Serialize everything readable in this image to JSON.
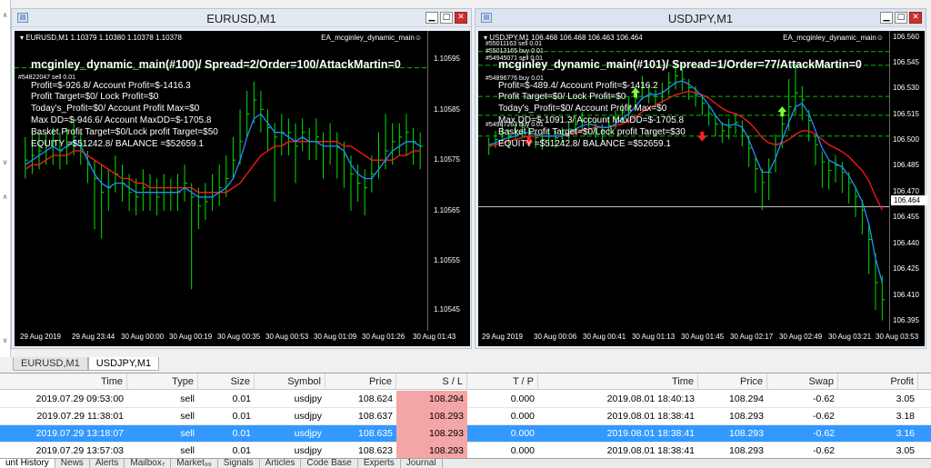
{
  "left_pane": {
    "arrows": [
      "∧",
      "∨",
      "∧",
      "∨"
    ]
  },
  "colors": {
    "bull": "#00e000",
    "ma_fast": "#1e90ff",
    "ma_slow": "#ff1a1a",
    "level": "#00c000",
    "buy_arrow": "#7cff3a",
    "sell_arrow": "#ff2020"
  },
  "charts": [
    {
      "window_title": "EURUSD,M1",
      "header": "▾ EURUSD,M1  1.10379 1.10380 1.10378 1.10378",
      "ea_name": "EA_mcginley_dynamic_main☺",
      "title": "mcginley_dynamic_main(#100)/ Spread=2/Order=100/AttackMartin=0",
      "order_label": "#54822047 sell 0.01",
      "extra_labels": [],
      "lines": [
        "Profit=$-926.8/ Account Profit=$-1416.3",
        "Profit Target=$0/ Lock Profit=$0",
        "Today's_Profit=$0/ Account Profit Max=$0",
        "Max DD=$-946.6/ Account MaxDD=$-1705.8",
        "Basket Profit Target=$0/Lock profit Target=$50",
        "EQUITY =$51242.8/ BALANCE =$52659.1"
      ],
      "price_labels": [
        "1.10595",
        "1.10585",
        "1.10575",
        "1.10565",
        "1.10555",
        "1.10545"
      ],
      "current_price": "",
      "time_labels": [
        "29 Aug 2019",
        "29 Aug 23:44",
        "30 Aug 00:00",
        "30 Aug 00:19",
        "30 Aug 00:35",
        "30 Aug 00:53",
        "30 Aug 01:09",
        "30 Aug 01:26",
        "30 Aug 01:43"
      ],
      "series": {
        "close": [
          1.10572,
          1.10573,
          1.10574,
          1.10575,
          1.10576,
          1.10574,
          1.10575,
          1.10577,
          1.10575,
          1.10571,
          1.10568,
          1.10565,
          1.10566,
          1.10569,
          1.10567,
          1.10565,
          1.10564,
          1.10566,
          1.10565,
          1.10564,
          1.10566,
          1.10565,
          1.10565,
          1.10567,
          1.10564,
          1.10562,
          1.10563,
          1.10565,
          1.10566,
          1.10568,
          1.10572,
          1.10576,
          1.10582,
          1.10585,
          1.10583,
          1.10579,
          1.10577,
          1.10578,
          1.10578,
          1.10575,
          1.10578,
          1.10576,
          1.10577,
          1.10575,
          1.10576,
          1.10575,
          1.10573,
          1.10569,
          1.10567,
          1.10566,
          1.10569,
          1.10572,
          1.10574,
          1.10576,
          1.10577,
          1.10578,
          1.10576,
          1.10575
        ],
        "high": [
          1.10577,
          1.10578,
          1.10578,
          1.10578,
          1.10579,
          1.10578,
          1.10579,
          1.10581,
          1.10578,
          1.10574,
          1.10572,
          1.10571,
          1.1057,
          1.10573,
          1.10571,
          1.10569,
          1.10568,
          1.1057,
          1.10569,
          1.10568,
          1.10569,
          1.10568,
          1.10569,
          1.10571,
          1.10567,
          1.10566,
          1.10567,
          1.10569,
          1.10571,
          1.10573,
          1.10577,
          1.10583,
          1.10587,
          1.10589,
          1.10587,
          1.10583,
          1.1058,
          1.10582,
          1.10581,
          1.1058,
          1.10581,
          1.10579,
          1.10581,
          1.10578,
          1.1058,
          1.10578,
          1.10576,
          1.10573,
          1.10571,
          1.1057,
          1.10573,
          1.10578,
          1.10582,
          1.1058,
          1.1058,
          1.10582,
          1.10579,
          1.10578
        ],
        "low": [
          1.10568,
          1.10569,
          1.1057,
          1.10571,
          1.10571,
          1.1057,
          1.10571,
          1.10573,
          1.10571,
          1.10567,
          1.10557,
          1.10555,
          1.10561,
          1.10565,
          1.10563,
          1.10561,
          1.1056,
          1.10561,
          1.10561,
          1.1056,
          1.10561,
          1.10561,
          1.10561,
          1.10563,
          1.10544,
          1.10557,
          1.10559,
          1.10561,
          1.10562,
          1.10564,
          1.10568,
          1.10571,
          1.10577,
          1.1058,
          1.10578,
          1.10574,
          1.10563,
          1.10573,
          1.10573,
          1.10567,
          1.10574,
          1.10572,
          1.10572,
          1.10568,
          1.10571,
          1.10568,
          1.10566,
          1.10561,
          1.10563,
          1.1056,
          1.10565,
          1.10568,
          1.1057,
          1.10571,
          1.10573,
          1.10573,
          1.10571,
          1.1057
        ],
        "ma_fast": [
          1.10571,
          1.10572,
          1.10573,
          1.10574,
          1.10575,
          1.10574,
          1.10575,
          1.10576,
          1.10575,
          1.10572,
          1.10569,
          1.10567,
          1.10566,
          1.10567,
          1.10567,
          1.10566,
          1.10565,
          1.10565,
          1.10565,
          1.10565,
          1.10565,
          1.10565,
          1.10565,
          1.10566,
          1.10565,
          1.10564,
          1.10564,
          1.10564,
          1.10565,
          1.10566,
          1.10568,
          1.10572,
          1.10577,
          1.10581,
          1.10582,
          1.1058,
          1.10578,
          1.10578,
          1.10577,
          1.10576,
          1.10577,
          1.10576,
          1.10576,
          1.10575,
          1.10575,
          1.10575,
          1.10574,
          1.10571,
          1.10569,
          1.10568,
          1.10568,
          1.1057,
          1.10572,
          1.10574,
          1.10575,
          1.10576,
          1.10576,
          1.10575
        ],
        "ma_slow": [
          1.1057,
          1.10571,
          1.10571,
          1.10572,
          1.10573,
          1.10573,
          1.10573,
          1.10574,
          1.10574,
          1.10573,
          1.10572,
          1.10571,
          1.1057,
          1.10569,
          1.10568,
          1.10568,
          1.10567,
          1.10567,
          1.10566,
          1.10566,
          1.10566,
          1.10566,
          1.10566,
          1.10566,
          1.10566,
          1.10565,
          1.10565,
          1.10565,
          1.10565,
          1.10565,
          1.10566,
          1.10567,
          1.10569,
          1.10571,
          1.10573,
          1.10574,
          1.10575,
          1.10575,
          1.10576,
          1.10576,
          1.10576,
          1.10576,
          1.10576,
          1.10576,
          1.10576,
          1.10576,
          1.10575,
          1.10575,
          1.10574,
          1.10573,
          1.10572,
          1.10572,
          1.10572,
          1.10572,
          1.10573,
          1.10573,
          1.10574,
          1.10574
        ],
        "y_max": 1.106,
        "y_min": 1.10535,
        "levels": [
          1.10592
        ],
        "current": null,
        "buy_arrows": [],
        "sell_arrows": []
      }
    },
    {
      "window_title": "USDJPY,M1",
      "header": "▾ USDJPY,M1  106.468 106.468 106.463 106.464",
      "ea_name": "EA_mcginley_dynamic_main☺",
      "title": "mcginley_dynamic_main(#101)/ Spread=1/Order=77/AttackMartin=0",
      "order_label": "#54896776 buy 0.01",
      "extra_labels": [
        "#55011163 sell 0.01",
        "#55013165 buy 0.01",
        "#54945071 sell 0.01",
        "#54987263 buy 0.01"
      ],
      "lines": [
        "Profit=$-489.4/ Account Profit=$-1416.2",
        "Profit Target=$0/ Lock Profit=$0",
        "Today's_Profit=$0/ Account Profit Max=$0",
        "Max DD=$-1091.3/ Account MaxDD=$-1705.8",
        "Basket Profit Target=$0/Lock profit Target=$30",
        "EQUITY =$51242.8/ BALANCE =$52659.1"
      ],
      "price_labels": [
        "106.560",
        "106.545",
        "106.530",
        "106.515",
        "106.500",
        "106.485",
        "106.470",
        "106.455",
        "106.440",
        "106.425",
        "106.410",
        "106.395"
      ],
      "current_price": "106.464",
      "time_labels": [
        "29 Aug 2019",
        "30 Aug 00:06",
        "30 Aug 00:41",
        "30 Aug 01:13",
        "30 Aug 01:45",
        "30 Aug 02:17",
        "30 Aug 02:49",
        "30 Aug 03:21",
        "30 Aug 03:53"
      ],
      "series": {
        "close": [
          106.5,
          106.503,
          106.507,
          106.505,
          106.508,
          106.51,
          106.506,
          106.504,
          106.503,
          106.505,
          106.504,
          106.506,
          106.509,
          106.512,
          106.514,
          106.512,
          106.51,
          106.508,
          106.511,
          106.515,
          106.519,
          106.522,
          106.527,
          106.533,
          106.53,
          106.528,
          106.531,
          106.536,
          106.54,
          106.538,
          106.533,
          106.529,
          106.524,
          106.518,
          106.512,
          106.508,
          106.51,
          106.513,
          106.508,
          106.498,
          106.486,
          106.478,
          106.484,
          106.5,
          106.512,
          106.522,
          106.53,
          106.526,
          106.514,
          106.5,
          106.49,
          106.485,
          106.488,
          106.484,
          106.478,
          106.47,
          106.462,
          106.445,
          106.42,
          106.41
        ],
        "high": [
          106.504,
          106.508,
          106.512,
          106.509,
          106.512,
          106.514,
          106.51,
          106.508,
          106.507,
          106.509,
          106.508,
          106.51,
          106.513,
          106.517,
          106.519,
          106.516,
          106.514,
          106.512,
          106.516,
          106.52,
          106.524,
          106.528,
          106.534,
          106.54,
          106.535,
          106.532,
          106.536,
          106.542,
          106.548,
          106.544,
          106.538,
          106.534,
          106.529,
          106.523,
          106.517,
          106.513,
          106.515,
          106.518,
          106.514,
          106.505,
          106.493,
          106.486,
          106.492,
          106.506,
          106.519,
          106.538,
          106.547,
          106.534,
          106.52,
          106.506,
          106.496,
          106.491,
          106.494,
          106.49,
          106.484,
          106.476,
          106.468,
          106.454,
          106.437,
          106.424
        ],
        "low": [
          106.494,
          106.498,
          106.501,
          106.499,
          106.502,
          106.504,
          106.5,
          106.498,
          106.497,
          106.499,
          106.498,
          106.501,
          106.503,
          106.506,
          106.508,
          106.506,
          106.504,
          106.502,
          106.505,
          106.509,
          106.513,
          106.516,
          106.52,
          106.526,
          106.524,
          106.522,
          106.524,
          106.529,
          106.532,
          106.531,
          106.526,
          106.522,
          106.517,
          106.511,
          106.505,
          106.501,
          106.503,
          106.506,
          106.499,
          106.487,
          106.472,
          106.462,
          106.468,
          106.484,
          106.498,
          106.508,
          106.517,
          106.514,
          106.502,
          106.488,
          106.475,
          106.474,
          106.478,
          106.472,
          106.466,
          106.458,
          106.448,
          106.425,
          106.404,
          106.398
        ],
        "ma_fast": [
          106.5,
          106.501,
          106.503,
          106.504,
          106.505,
          106.507,
          106.507,
          106.506,
          106.505,
          106.505,
          106.505,
          106.505,
          106.507,
          106.509,
          106.511,
          106.512,
          106.511,
          106.51,
          106.51,
          106.512,
          106.515,
          106.518,
          106.522,
          106.527,
          106.529,
          106.529,
          106.53,
          106.533,
          106.536,
          106.537,
          106.535,
          106.532,
          106.528,
          106.523,
          106.517,
          106.512,
          106.511,
          106.512,
          106.51,
          106.503,
          106.493,
          106.484,
          106.484,
          106.492,
          106.503,
          106.513,
          106.522,
          106.524,
          106.518,
          106.508,
          106.498,
          106.491,
          106.489,
          106.487,
          106.482,
          106.475,
          106.467,
          106.454,
          106.434,
          106.42
        ],
        "ma_slow": [
          106.499,
          106.5,
          106.501,
          106.502,
          106.503,
          106.504,
          106.505,
          106.505,
          106.505,
          106.505,
          106.505,
          106.505,
          106.506,
          106.507,
          106.508,
          106.509,
          106.51,
          106.51,
          106.51,
          106.511,
          106.512,
          106.514,
          106.516,
          106.519,
          106.521,
          106.523,
          106.525,
          106.527,
          106.529,
          106.53,
          106.531,
          106.53,
          106.529,
          106.527,
          106.524,
          106.521,
          106.519,
          106.518,
          106.516,
          106.513,
          106.509,
          106.504,
          106.501,
          106.5,
          106.501,
          106.503,
          106.506,
          106.508,
          106.508,
          106.506,
          106.503,
          106.5,
          106.498,
          106.496,
          106.493,
          106.489,
          106.485,
          106.479,
          106.47,
          106.462
        ],
        "y_max": 106.566,
        "y_min": 106.392,
        "levels": [
          106.554,
          106.546,
          106.528,
          106.517,
          106.505
        ],
        "current": 106.464,
        "buy_arrows": [
          [
            22,
            106.53
          ],
          [
            44,
            106.519
          ]
        ],
        "sell_arrows": [
          [
            6,
            106.502
          ],
          [
            32,
            106.505
          ]
        ]
      }
    }
  ],
  "chart_tabs": [
    "EURUSD,M1",
    "USDJPY,M1"
  ],
  "table": {
    "headers": [
      "Time",
      "Type",
      "Size",
      "Symbol",
      "Price",
      "S / L",
      "T / P",
      "Time",
      "Price",
      "Swap",
      "Profit"
    ],
    "rows": [
      [
        "2019.07.29 09:53:00",
        "sell",
        "0.01",
        "usdjpy",
        "108.624",
        "108.294",
        "0.000",
        "2019.08.01 18:40:13",
        "108.294",
        "-0.62",
        "3.05"
      ],
      [
        "2019.07.29 11:38:01",
        "sell",
        "0.01",
        "usdjpy",
        "108.637",
        "108.293",
        "0.000",
        "2019.08.01 18:38:41",
        "108.293",
        "-0.62",
        "3.18"
      ],
      [
        "2019.07.29 13:18:07",
        "sell",
        "0.01",
        "usdjpy",
        "108.635",
        "108.293",
        "0.000",
        "2019.08.01 18:38:41",
        "108.293",
        "-0.62",
        "3.16"
      ],
      [
        "2019.07.29 13:57:03",
        "sell",
        "0.01",
        "usdjpy",
        "108.623",
        "108.293",
        "0.000",
        "2019.08.01 18:38:41",
        "108.293",
        "-0.62",
        "3.05"
      ]
    ],
    "selected_row": 2
  },
  "bottom_tabs": [
    "unt History",
    "News",
    "Alerts",
    "Mailbox₇",
    "Market₉₉",
    "Signals",
    "Articles",
    "Code Base",
    "Experts",
    "Journal"
  ]
}
